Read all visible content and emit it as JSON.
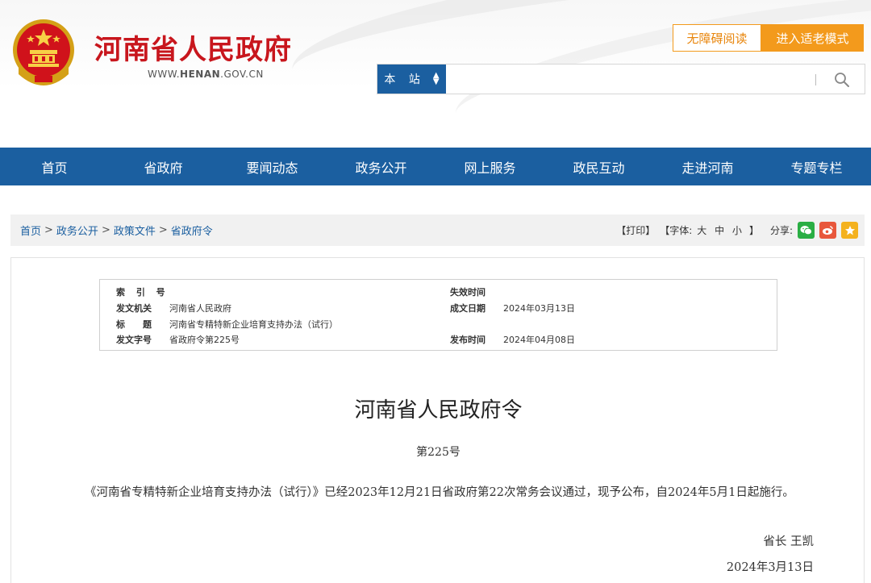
{
  "header": {
    "site_title": "河南省人民政府",
    "site_url_prefix": "WWW.",
    "site_url_domain": "HENAN",
    "site_url_suffix": ".GOV.CN",
    "accessible_label": "无障碍阅读",
    "elder_mode_label": "进入适老模式",
    "search": {
      "scope": "本 站",
      "placeholder": ""
    },
    "colors": {
      "title_red": "#c8161d",
      "accent_orange": "#f39a1c",
      "nav_blue": "#1b5fa0"
    }
  },
  "nav": {
    "items": [
      "首页",
      "省政府",
      "要闻动态",
      "政务公开",
      "网上服务",
      "政民互动",
      "走进河南",
      "专题专栏"
    ]
  },
  "breadcrumb": {
    "items": [
      "首页",
      "政务公开",
      "政策文件",
      "省政府令"
    ],
    "separator": ">"
  },
  "tools": {
    "print": "【打印】",
    "font_label": "【字体:",
    "font_sizes": "大 中 小",
    "font_close": "】",
    "share_label": "分享:",
    "share_icons": [
      "wechat-icon",
      "weibo-icon",
      "qzone-icon"
    ]
  },
  "meta": {
    "index_label": "索 引 号",
    "index_value": "",
    "expire_label": "失效时间",
    "expire_value": "",
    "issuer_label": "发文机关",
    "issuer_value": "河南省人民政府",
    "date_label": "成文日期",
    "date_value": "2024年03月13日",
    "title_label": "标　　题",
    "title_value": "河南省专精特新企业培育支持办法（试行）",
    "docno_label": "发文字号",
    "docno_value": "省政府令第225号",
    "publish_label": "发布时间",
    "publish_value": "2024年04月08日"
  },
  "document": {
    "title": "河南省人民政府令",
    "number": "第225号",
    "body": "《河南省专精特新企业培育支持办法（试行）》已经2023年12月21日省政府第22次常务会议通过，现予公布，自2024年5月1日起施行。",
    "signer": "省长 王凯",
    "sign_date": "2024年3月13日"
  }
}
